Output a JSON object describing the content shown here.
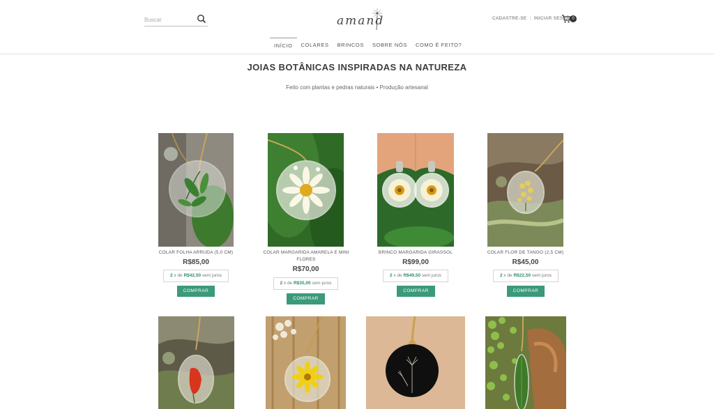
{
  "header": {
    "search_placeholder": "Buscar",
    "logo_text": "amand",
    "register_label": "CADASTRE-SE",
    "login_label": "INICIAR SESSÃO",
    "cart_count": "0"
  },
  "nav": {
    "items": [
      {
        "label": "INÍCIO"
      },
      {
        "label": "COLARES"
      },
      {
        "label": "BRINCOS"
      },
      {
        "label": "SOBRE NÓS"
      },
      {
        "label": "COMO É FEITO?"
      }
    ]
  },
  "main": {
    "title": "JOIAS BOTÂNICAS INSPIRADAS NA NATUREZA",
    "subtitle": "Feito com plantas e pedras naturais • Produção artesanal"
  },
  "products": [
    {
      "name": "COLAR FOLHA ARRUDA (5,0 CM)",
      "price": "R$85,00",
      "inst_count": "2",
      "inst_text": " x de ",
      "inst_value": "R$42,50",
      "inst_suffix": " sem juros",
      "buy_label": "COMPRAR"
    },
    {
      "name": "COLAR MARGARIDA AMARELA E MINI FLORES",
      "price": "R$70,00",
      "inst_count": "2",
      "inst_text": " x de ",
      "inst_value": "R$35,00",
      "inst_suffix": " sem juros",
      "buy_label": "COMPRAR"
    },
    {
      "name": "BRINCO MARGARIDA GIRASSOL",
      "price": "R$99,00",
      "inst_count": "2",
      "inst_text": " x de ",
      "inst_value": "R$49,50",
      "inst_suffix": " sem juros",
      "buy_label": "COMPRAR"
    },
    {
      "name": "COLAR FLOR DE TANGO (2,5 CM)",
      "price": "R$45,00",
      "inst_count": "2",
      "inst_text": " x de ",
      "inst_value": "R$22,50",
      "inst_suffix": " sem juros",
      "buy_label": "COMPRAR"
    }
  ],
  "colors": {
    "accent": "#3a9a7a",
    "installment_highlight": "#2e8b6a"
  }
}
